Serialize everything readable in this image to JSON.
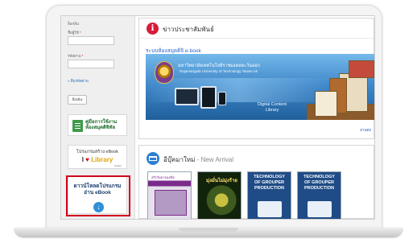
{
  "sidebar": {
    "login_label": "ล็อกอิน",
    "username_label": "ชื่อผู้ใช้",
    "password_label": "รหัสผ่าน",
    "required_mark": "*",
    "forgot_password_link": "» ลืมรหัสผ่าน",
    "login_button": "ล็อกอิน",
    "manual_banner": {
      "line1": "คู่มือการใช้งาน",
      "line2": "ห้องสมุดดิจิทัล"
    },
    "ebook_banner": {
      "line1": "โปรแกรมสร้าง eBook",
      "heart_prefix": "I",
      "heart": "♥",
      "line2": "Library",
      "small": "builder"
    },
    "download_banner": {
      "line1": "ดาวน์โหลดโปรแกรม",
      "line2": "อ่าน eBook",
      "icon": "↓"
    }
  },
  "news": {
    "icon_symbol": "i",
    "title": "ข่าวประชาสัมพันธ์",
    "ebook_link": "ระบบห้องสมุดดิจิ e-book",
    "banner": {
      "university_th": "มหาวิทยาลัยเทคโนโลยีราชมงคลตะวันออก",
      "university_en": "Rajamangala University of Technology Tawan-ok",
      "caption_line1": "Digital Content",
      "caption_line2": "Library"
    },
    "more_link": "อ่านต่อ"
  },
  "new_arrival": {
    "title": "อีบุ๊คมาใหม่",
    "subtitle": " - New Arrival",
    "covers": [
      {
        "title": "สรีรวิทยาของพืช"
      },
      {
        "title": "มุ่งมั่นไม่มุ่งร้าย"
      },
      {
        "line1": "TECHNOLOGY",
        "line2": "OF GROUPER",
        "line3": "PRODUCTION"
      },
      {
        "line1": "TECHNOLOGY",
        "line2": "OF GROUPER",
        "line3": "PRODUCTION"
      }
    ]
  }
}
